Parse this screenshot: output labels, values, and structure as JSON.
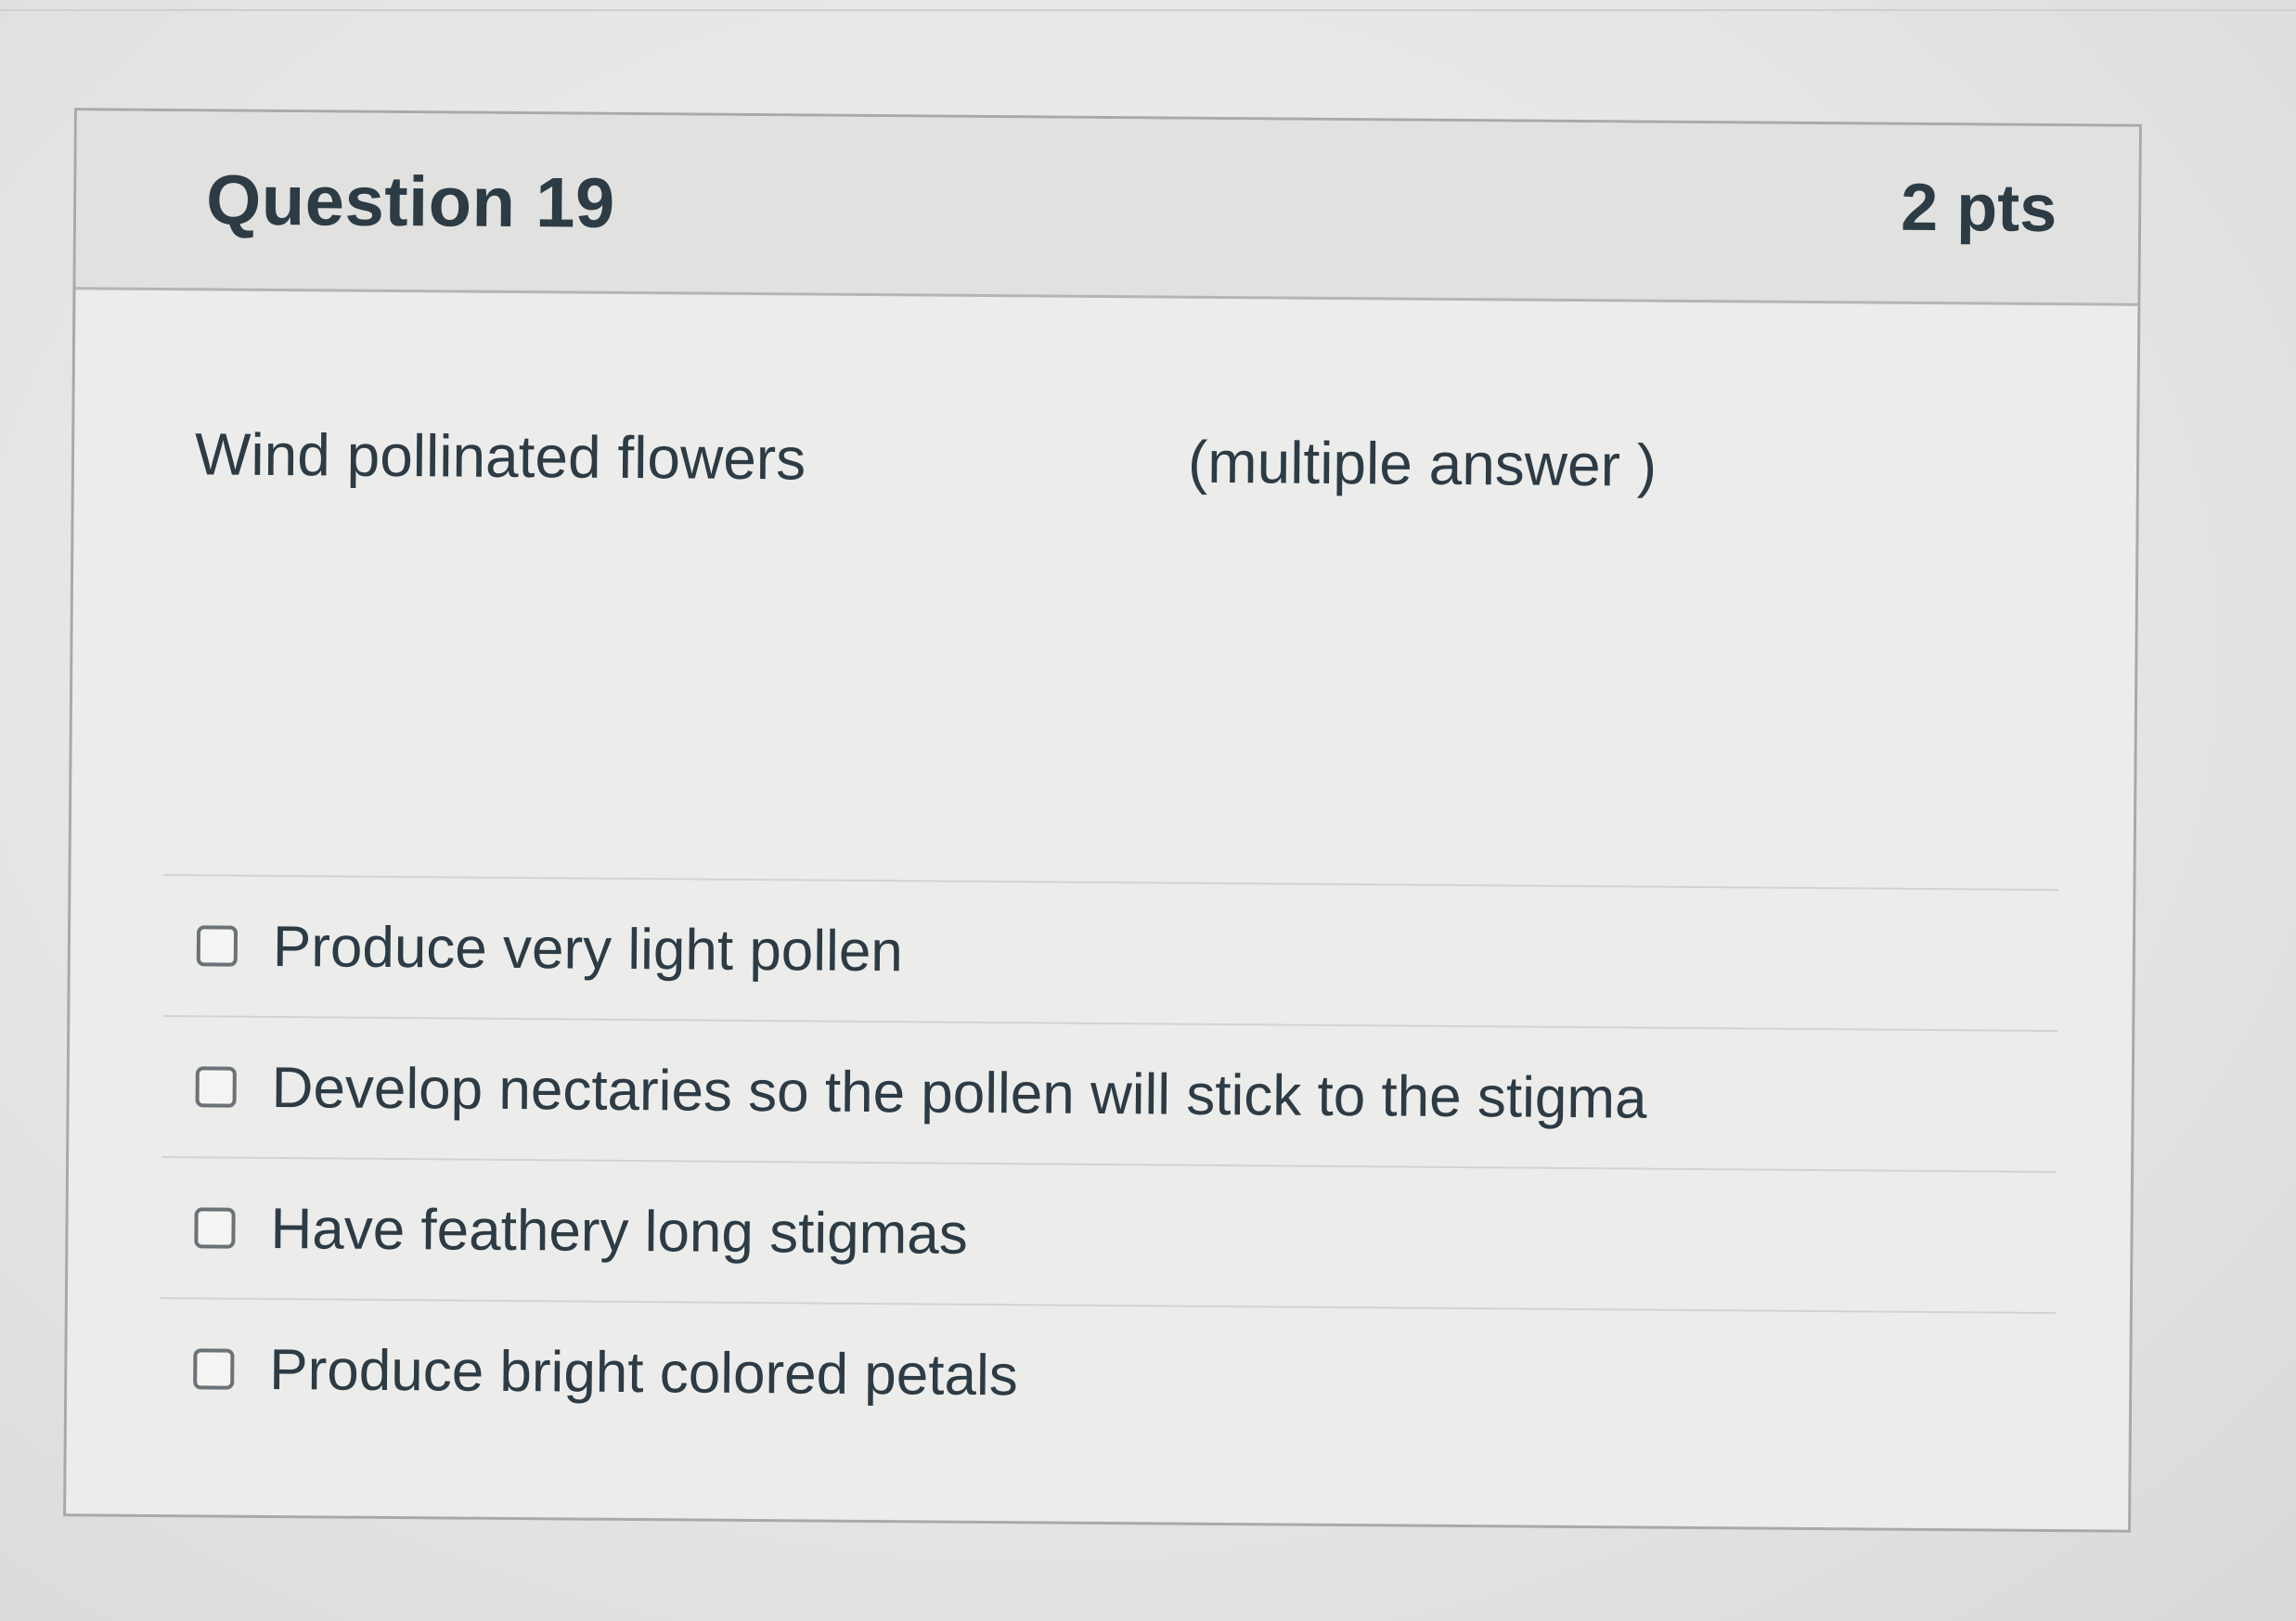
{
  "question": {
    "title": "Question 19",
    "points": "2 pts",
    "text": "Wind pollinated flowers",
    "hint": "(multiple answer )"
  },
  "answers": [
    {
      "label": "Produce very light pollen",
      "checked": false
    },
    {
      "label": "Develop nectaries so the pollen will stick to the stigma",
      "checked": false
    },
    {
      "label": "Have feathery long stigmas",
      "checked": false
    },
    {
      "label": "Produce bright colored petals",
      "checked": false
    }
  ],
  "colors": {
    "text": "#2d3b45",
    "header_background": "#e1e2e0",
    "card_background": "#ecedeb",
    "border": "#a8aaa8"
  }
}
